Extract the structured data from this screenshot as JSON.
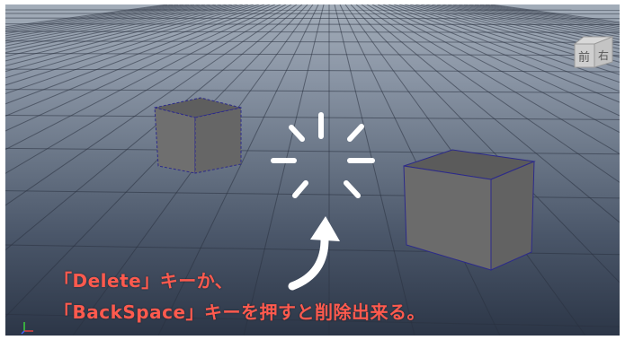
{
  "view_cube": {
    "front_label": "前",
    "right_label": "右"
  },
  "caption": {
    "line1": "「Delete」キーか、",
    "line2": "「BackSpace」キーを押すと削除出来る。"
  },
  "colors": {
    "caption_text": "#ff5a4e",
    "cube_face": "#6e6e6e",
    "selection_wire": "#2c2a8a",
    "spark": "#ffffff"
  },
  "icons": [
    "view-cube-icon",
    "sparkle-burst-icon",
    "curved-arrow-icon",
    "axis-gizmo-icon"
  ]
}
